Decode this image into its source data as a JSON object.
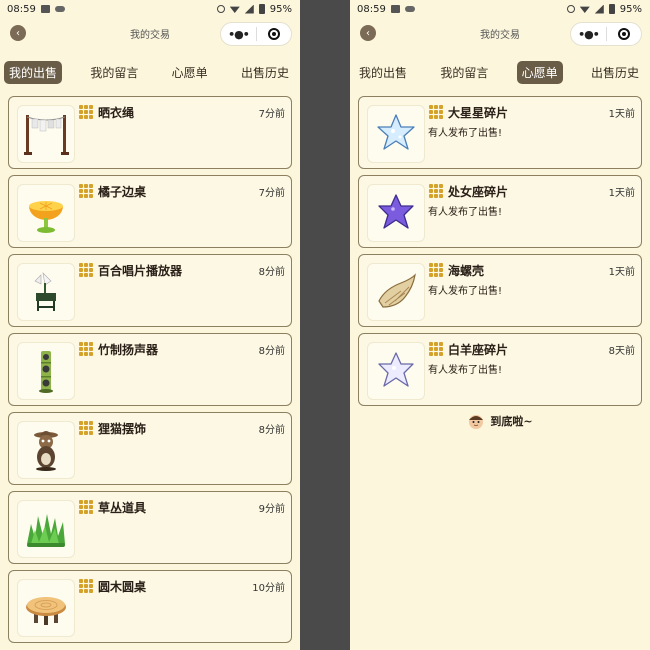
{
  "status_bar": {
    "time": "08:59",
    "battery": "95%"
  },
  "navbar": {
    "title": "我的交易"
  },
  "left": {
    "tabs": [
      "我的出售",
      "我的留言",
      "心愿单",
      "出售历史"
    ],
    "active_tab": 0,
    "items": [
      {
        "name": "晒衣绳",
        "time": "7分前",
        "icon": "clothesline-icon"
      },
      {
        "name": "橘子边桌",
        "time": "7分前",
        "icon": "orange-table-icon"
      },
      {
        "name": "百合唱片播放器",
        "time": "8分前",
        "icon": "lily-record-player-icon"
      },
      {
        "name": "竹制扬声器",
        "time": "8分前",
        "icon": "bamboo-speaker-icon"
      },
      {
        "name": "狸猫摆饰",
        "time": "8分前",
        "icon": "tanuki-figure-icon"
      },
      {
        "name": "草丛道具",
        "time": "9分前",
        "icon": "grass-bush-icon"
      },
      {
        "name": "圆木圆桌",
        "time": "10分前",
        "icon": "log-table-icon"
      }
    ]
  },
  "right": {
    "tabs": [
      "我的出售",
      "我的留言",
      "心愿单",
      "出售历史"
    ],
    "active_tab": 2,
    "items": [
      {
        "name": "大星星碎片",
        "time": "1天前",
        "subtitle": "有人发布了出售!",
        "icon": "large-star-fragment-icon"
      },
      {
        "name": "处女座碎片",
        "time": "1天前",
        "subtitle": "有人发布了出售!",
        "icon": "virgo-fragment-icon"
      },
      {
        "name": "海螺壳",
        "time": "1天前",
        "subtitle": "有人发布了出售!",
        "icon": "conch-shell-icon"
      },
      {
        "name": "白羊座碎片",
        "time": "8天前",
        "subtitle": "有人发布了出售!",
        "icon": "aries-fragment-icon"
      }
    ],
    "end_text": "到底啦~"
  },
  "colors": {
    "background": "#fbf6dc",
    "active_tab": "#6a5d48",
    "card_border": "#8d8060",
    "grid_icon": "#d4a22a"
  }
}
